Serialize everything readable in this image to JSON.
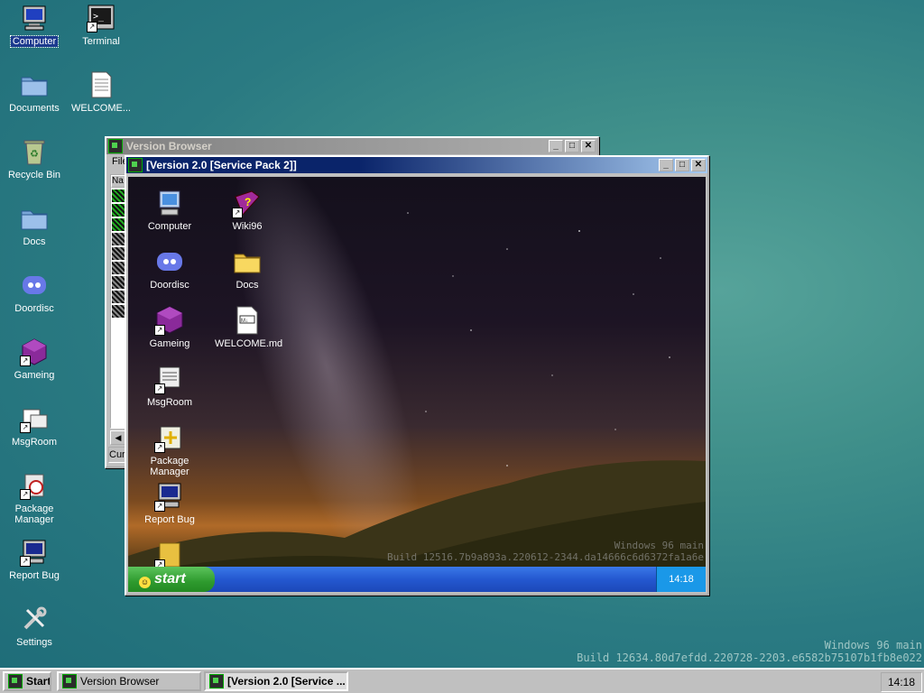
{
  "desktop": {
    "icons": [
      {
        "label": "Computer"
      },
      {
        "label": "Terminal"
      },
      {
        "label": "Documents"
      },
      {
        "label": "WELCOME..."
      },
      {
        "label": "Recycle Bin"
      },
      {
        "label": "Docs"
      },
      {
        "label": "Doordisc"
      },
      {
        "label": "Gameing"
      },
      {
        "label": "MsgRoom"
      },
      {
        "label": "Package Manager"
      },
      {
        "label": "Report Bug"
      },
      {
        "label": "Settings"
      }
    ],
    "watermark": {
      "line1": "Windows 96 main",
      "line2": "Build 12634.80d7efdd.220728-2203.e6582b75107b1fb8e022"
    }
  },
  "version_browser": {
    "title": "Version Browser",
    "menu_first": "File",
    "col_header": "Na",
    "status": "Cur"
  },
  "vm_window": {
    "title": "[Version 2.0 [Service Pack 2]]",
    "icons": [
      {
        "label": "Computer"
      },
      {
        "label": "Wiki96"
      },
      {
        "label": "Doordisc"
      },
      {
        "label": "Docs"
      },
      {
        "label": "Gameing"
      },
      {
        "label": "WELCOME.md"
      },
      {
        "label": "MsgRoom"
      },
      {
        "label": "Package Manager"
      },
      {
        "label": "Report Bug"
      }
    ],
    "watermark": {
      "line1": "Windows 96 main",
      "line2": "Build 12516.7b9a893a.220612-2344.da14666c6d6372fa1a6e"
    },
    "start_label": "start",
    "clock": "14:18"
  },
  "taskbar": {
    "start_label": "Start",
    "items": [
      {
        "label": "Version Browser"
      },
      {
        "label": "[Version 2.0 [Service ..."
      }
    ],
    "clock": "14:18"
  }
}
